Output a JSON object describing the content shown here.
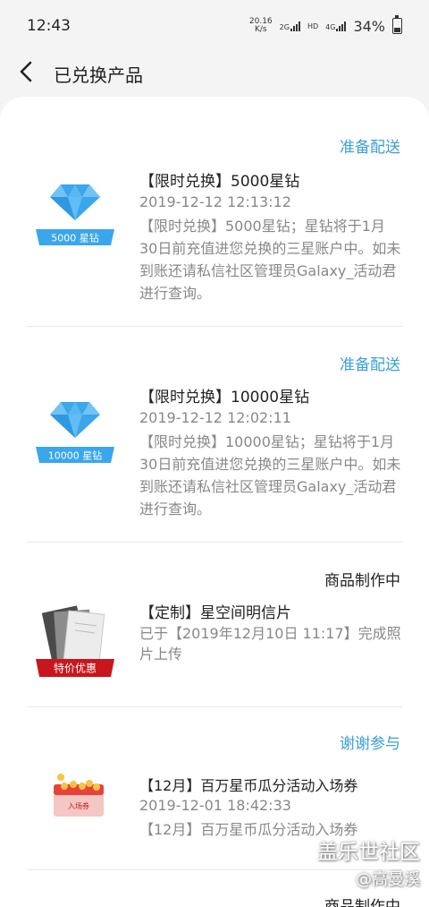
{
  "status_bar": {
    "time": "12:43",
    "net_speed_value": "20.16",
    "net_speed_unit": "K/s",
    "net_2g": "2G",
    "hd": "HD",
    "net_4g": "4G",
    "battery": "34%"
  },
  "header": {
    "title": "已兑换产品"
  },
  "items": [
    {
      "status": "准备配送",
      "title": "【限时兑换】5000星钻",
      "time": "2019-12-12 12:13:12",
      "description": "【限时兑换】5000星钻；星钻将于1月30日前充值进您兑换的三星账户中。如未到账还请私信社区管理员Galaxy_活动君进行查询。",
      "badge": "5000 星钻",
      "icon": "diamond-icon"
    },
    {
      "status": "准备配送",
      "title": "【限时兑换】10000星钻",
      "time": "2019-12-12 12:02:11",
      "description": "【限时兑换】10000星钻；星钻将于1月30日前充值进您兑换的三星账户中。如未到账还请私信社区管理员Galaxy_活动君进行查询。",
      "badge": "10000 星钻",
      "icon": "diamond-icon"
    },
    {
      "status": "商品制作中",
      "title": "【定制】星空间明信片",
      "description": "已于【2019年12月10日 11:17】完成照片上传",
      "badge": "特价优惠",
      "icon": "postcard-icon"
    },
    {
      "status": "谢谢参与",
      "title": "【12月】百万星币瓜分活动入场券",
      "time": "2019-12-01 18:42:33",
      "description": "【12月】百万星币瓜分活动入场券",
      "badge": "入场券",
      "icon": "ticket-icon"
    },
    {
      "status": "商品制作中"
    }
  ],
  "watermark": {
    "brand": "盖乐世社区",
    "user": "@高曼溪"
  },
  "colors": {
    "accent_blue": "#3a9fd6",
    "diamond_blue": "#3aa6ec",
    "badge_red": "#c8161d"
  }
}
